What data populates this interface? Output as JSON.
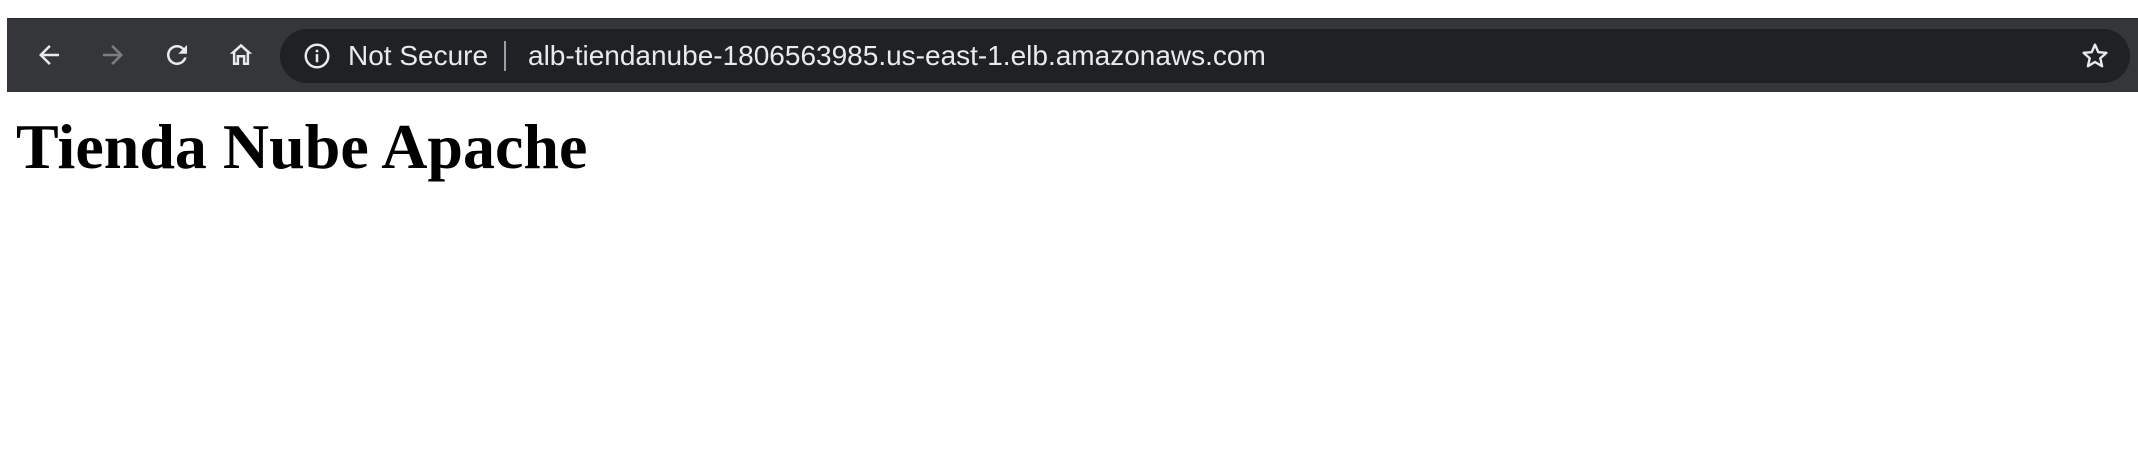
{
  "browser": {
    "nav": {
      "back": "back-icon",
      "forward": "forward-icon",
      "reload": "reload-icon",
      "home": "home-icon"
    },
    "omnibox": {
      "security_icon": "info-icon",
      "security_label": "Not Secure",
      "url": "alb-tiendanube-1806563985.us-east-1.elb.amazonaws.com",
      "bookmark_icon": "star-icon"
    },
    "colors": {
      "toolbar": "#35363a",
      "omnibox": "#202124",
      "text": "#e8eaed",
      "icon_active": "#e8eaed",
      "icon_disabled": "#7c7e82"
    }
  },
  "page": {
    "heading": "Tienda Nube Apache"
  }
}
